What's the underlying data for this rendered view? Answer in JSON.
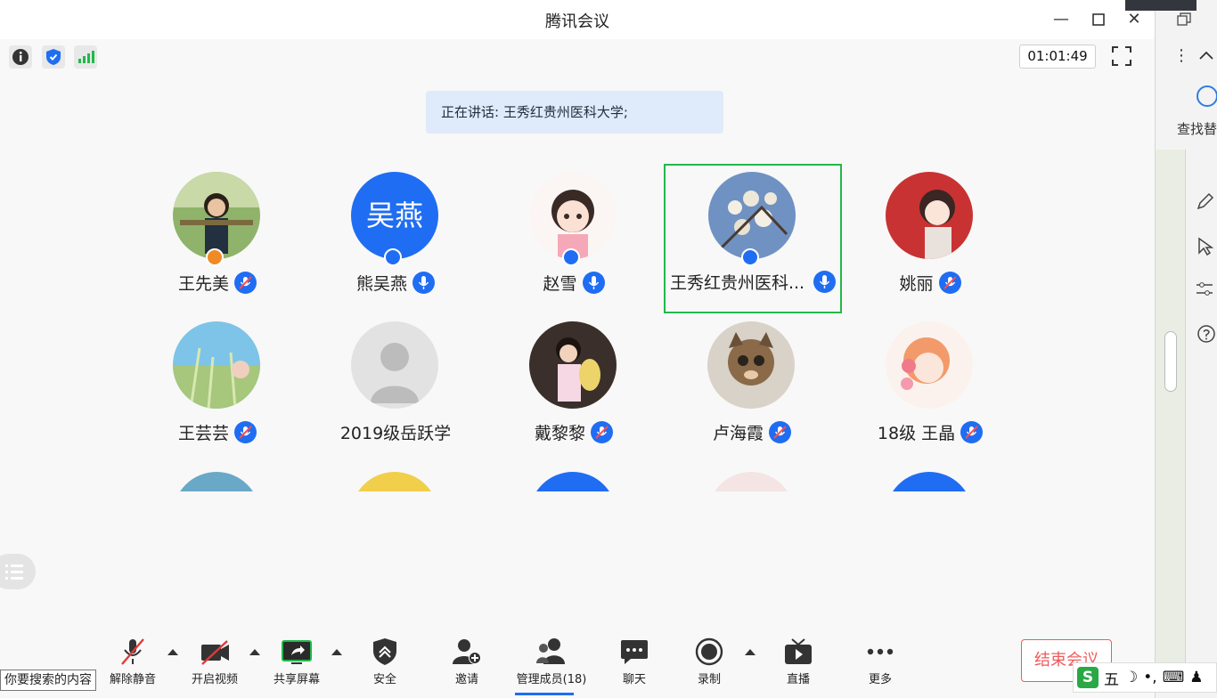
{
  "window": {
    "title": "腾讯会议",
    "timer": "01:01:49"
  },
  "speaking": "正在讲话: 王秀红贵州医科大学;",
  "participants": [
    {
      "name": "王先美",
      "muted": true
    },
    {
      "name": "熊吴燕",
      "muted": false,
      "avatar_text": "吴燕"
    },
    {
      "name": "赵雪",
      "muted": false
    },
    {
      "name": "王秀红贵州医科...",
      "muted": false,
      "active": true
    },
    {
      "name": "姚丽",
      "muted": true
    },
    {
      "name": "王芸芸",
      "muted": true
    },
    {
      "name": "2019级岳跃学",
      "muted": null
    },
    {
      "name": "戴黎黎",
      "muted": true
    },
    {
      "name": "卢海霞",
      "muted": true
    },
    {
      "name": "18级 王晶",
      "muted": true
    }
  ],
  "toolbar": {
    "unmute": "解除静音",
    "video": "开启视频",
    "share": "共享屏幕",
    "security": "安全",
    "invite": "邀请",
    "members": "管理成员(18)",
    "chat": "聊天",
    "record": "录制",
    "live": "直播",
    "more": "更多",
    "end": "结束会议"
  },
  "search_tip": "你要搜索的内容",
  "right_panel": {
    "find_label": "查找替"
  },
  "ime": {
    "mode": "五"
  },
  "colors": {
    "accent": "#1f6df3",
    "active_border": "#21b94a",
    "end_red": "#f05a5a",
    "speaking_bg": "#dfeafa"
  }
}
